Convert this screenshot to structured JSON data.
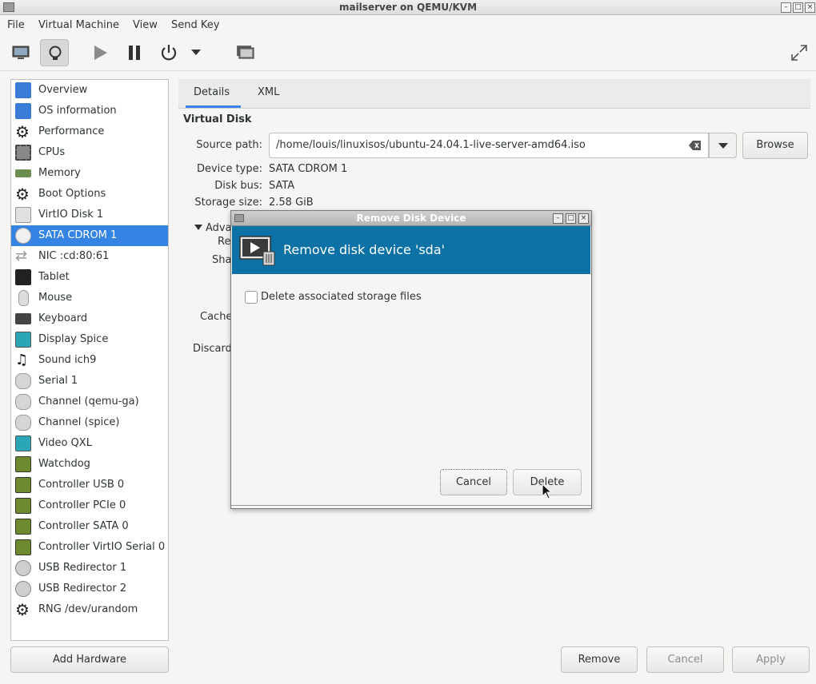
{
  "window": {
    "title": "mailserver on QEMU/KVM"
  },
  "menu": [
    "File",
    "Virtual Machine",
    "View",
    "Send Key"
  ],
  "sidebar": {
    "items": [
      {
        "label": "Overview",
        "icon": "monitor-icon"
      },
      {
        "label": "OS information",
        "icon": "monitor-icon"
      },
      {
        "label": "Performance",
        "icon": "gear-icon"
      },
      {
        "label": "CPUs",
        "icon": "cpu-icon"
      },
      {
        "label": "Memory",
        "icon": "memory-icon"
      },
      {
        "label": "Boot Options",
        "icon": "gear-icon"
      },
      {
        "label": "VirtIO Disk 1",
        "icon": "disk-icon"
      },
      {
        "label": "SATA CDROM 1",
        "icon": "cdrom-icon"
      },
      {
        "label": "NIC :cd:80:61",
        "icon": "network-icon"
      },
      {
        "label": "Tablet",
        "icon": "tablet-icon"
      },
      {
        "label": "Mouse",
        "icon": "mouse-icon"
      },
      {
        "label": "Keyboard",
        "icon": "keyboard-icon"
      },
      {
        "label": "Display Spice",
        "icon": "display-icon"
      },
      {
        "label": "Sound ich9",
        "icon": "sound-icon"
      },
      {
        "label": "Serial 1",
        "icon": "serial-icon"
      },
      {
        "label": "Channel (qemu-ga)",
        "icon": "channel-icon"
      },
      {
        "label": "Channel (spice)",
        "icon": "channel-icon"
      },
      {
        "label": "Video QXL",
        "icon": "display-icon"
      },
      {
        "label": "Watchdog",
        "icon": "pci-card-icon"
      },
      {
        "label": "Controller USB 0",
        "icon": "pci-card-icon"
      },
      {
        "label": "Controller PCIe 0",
        "icon": "pci-card-icon"
      },
      {
        "label": "Controller SATA 0",
        "icon": "pci-card-icon"
      },
      {
        "label": "Controller VirtIO Serial 0",
        "icon": "pci-card-icon"
      },
      {
        "label": "USB Redirector 1",
        "icon": "usb-icon"
      },
      {
        "label": "USB Redirector 2",
        "icon": "usb-icon"
      },
      {
        "label": "RNG /dev/urandom",
        "icon": "gear-icon"
      }
    ],
    "selected": "SATA CDROM 1",
    "add_button": "Add Hardware"
  },
  "tabs": [
    "Details",
    "XML"
  ],
  "details": {
    "section": "Virtual Disk",
    "source_path_label": "Source path:",
    "source_path_value": "/home/louis/linuxisos/ubuntu-24.04.1-live-server-amd64.iso",
    "browse": "Browse",
    "device_type_label": "Device type:",
    "device_type_value": "SATA CDROM 1",
    "disk_bus_label": "Disk bus:",
    "disk_bus_value": "SATA",
    "storage_size_label": "Storage size:",
    "storage_size_value": "2.58 GiB",
    "advanced_partial": "Adva",
    "readonly_partial": "Re",
    "shareable_partial": "Sha",
    "cache_partial": "Cache",
    "discard_partial": "Discard"
  },
  "footer": {
    "remove": "Remove",
    "cancel": "Cancel",
    "apply": "Apply"
  },
  "dialog": {
    "title": "Remove Disk Device",
    "header": "Remove disk device 'sda'",
    "checkbox_label": "Delete associated storage files",
    "checkbox_checked": false,
    "cancel": "Cancel",
    "delete": "Delete"
  },
  "colors": {
    "selection": "#3584e4",
    "dialog_header": "#0c72a5"
  }
}
